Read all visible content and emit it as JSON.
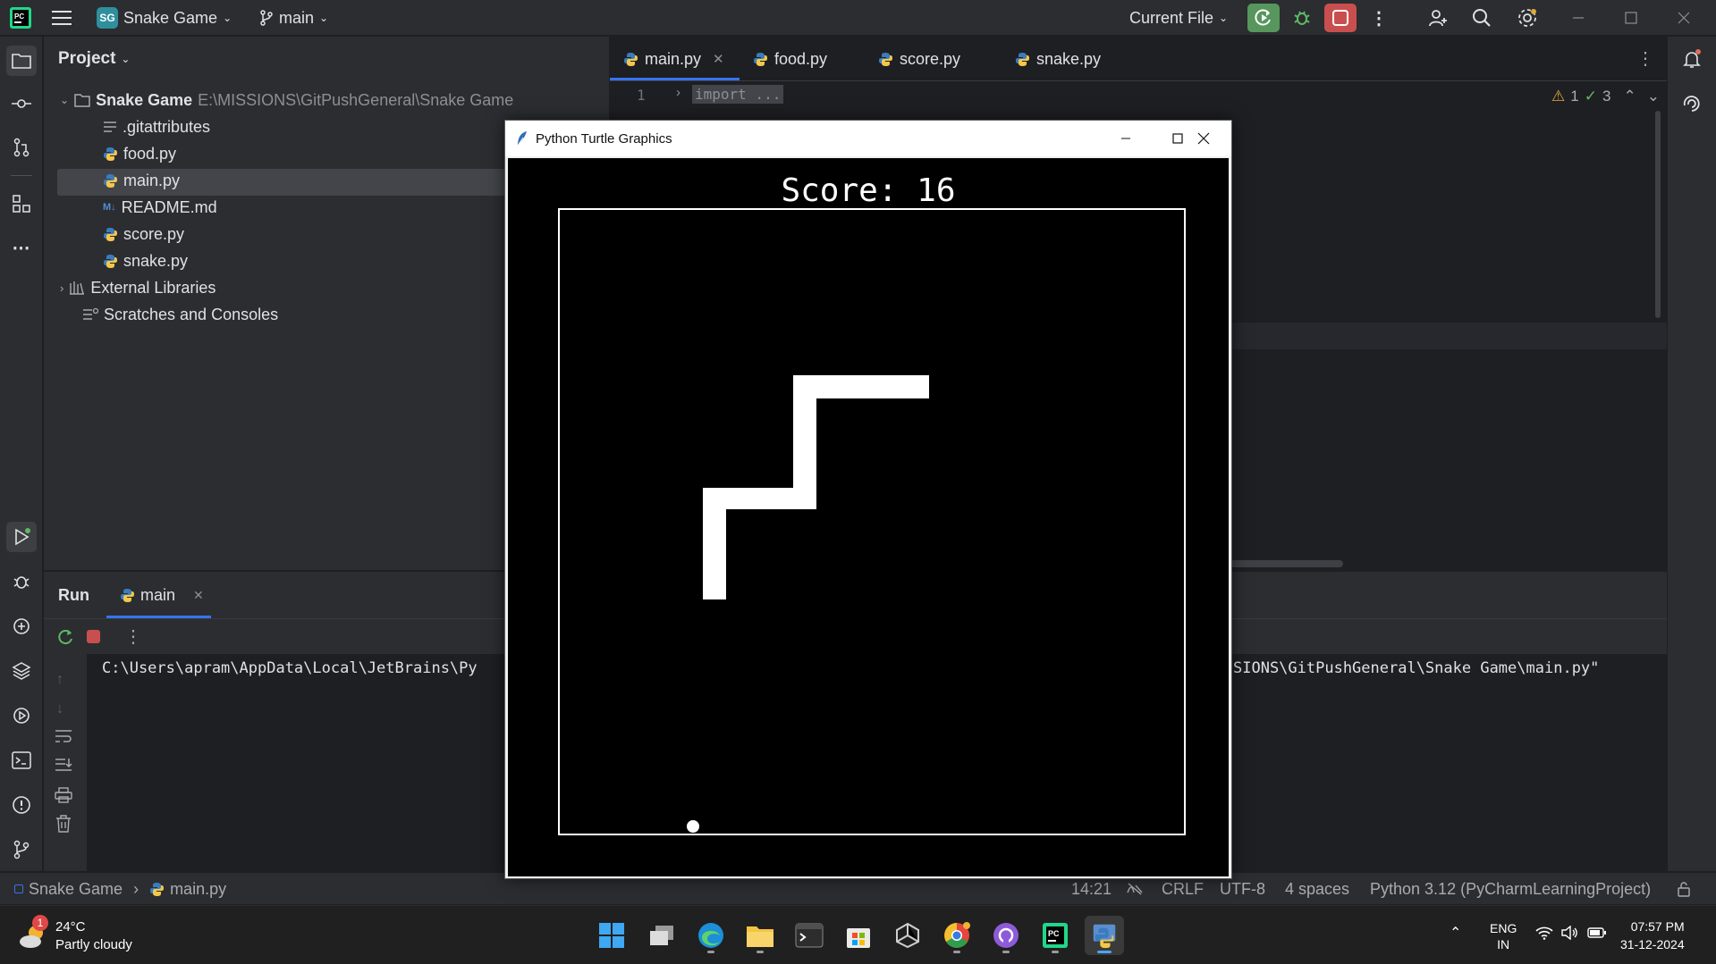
{
  "titlebar": {
    "project_badge": "SG",
    "project_name": "Snake Game",
    "branch": "main",
    "run_config": "Current File",
    "icons": [
      "pycharm-logo-icon",
      "hamburger-menu-icon",
      "branch-icon",
      "run-icon",
      "debug-icon",
      "stop-icon",
      "more-icon",
      "add-user-icon",
      "search-icon",
      "settings-icon",
      "minimize-icon",
      "maximize-icon",
      "close-icon"
    ]
  },
  "project_panel": {
    "title": "Project",
    "root": {
      "name": "Snake Game",
      "path": "E:\\MISSIONS\\GitPushGeneral\\Snake Game"
    },
    "files": [
      ".gitattributes",
      "food.py",
      "main.py",
      "README.md",
      "score.py",
      "snake.py"
    ],
    "selected": "main.py",
    "external_libraries": "External Libraries",
    "scratches": "Scratches and Consoles"
  },
  "editor": {
    "tabs": [
      "main.py",
      "food.py",
      "score.py",
      "snake.py"
    ],
    "active_tab": "main.py",
    "line_number": "1",
    "code_line": "import ...",
    "warnings": "1",
    "checks": "3"
  },
  "run_panel": {
    "title": "Run",
    "tab": "main",
    "console_left": "C:\\Users\\apram\\AppData\\Local\\JetBrains\\Py",
    "console_right": "SIONS\\GitPushGeneral\\Snake Game\\main.py\""
  },
  "statusbar": {
    "breadcrumb_project": "Snake Game",
    "breadcrumb_file": "main.py",
    "position": "14:21",
    "line_ending": "CRLF",
    "encoding": "UTF-8",
    "indent": "4 spaces",
    "interpreter": "Python 3.12 (PyCharmLearningProject)"
  },
  "taskbar": {
    "weather_temp": "24°C",
    "weather_desc": "Partly cloudy",
    "weather_badge": "1",
    "lang_top": "ENG",
    "lang_bottom": "IN",
    "time": "07:57 PM",
    "date": "31-12-2024"
  },
  "turtle_window": {
    "title": "Python Turtle Graphics",
    "score_text": "Score: 16"
  },
  "colors": {
    "accent": "#3574f0",
    "run_green": "#57965c",
    "stop_red": "#c94f4f",
    "snake": "#ffffff",
    "canvas": "#000000"
  }
}
